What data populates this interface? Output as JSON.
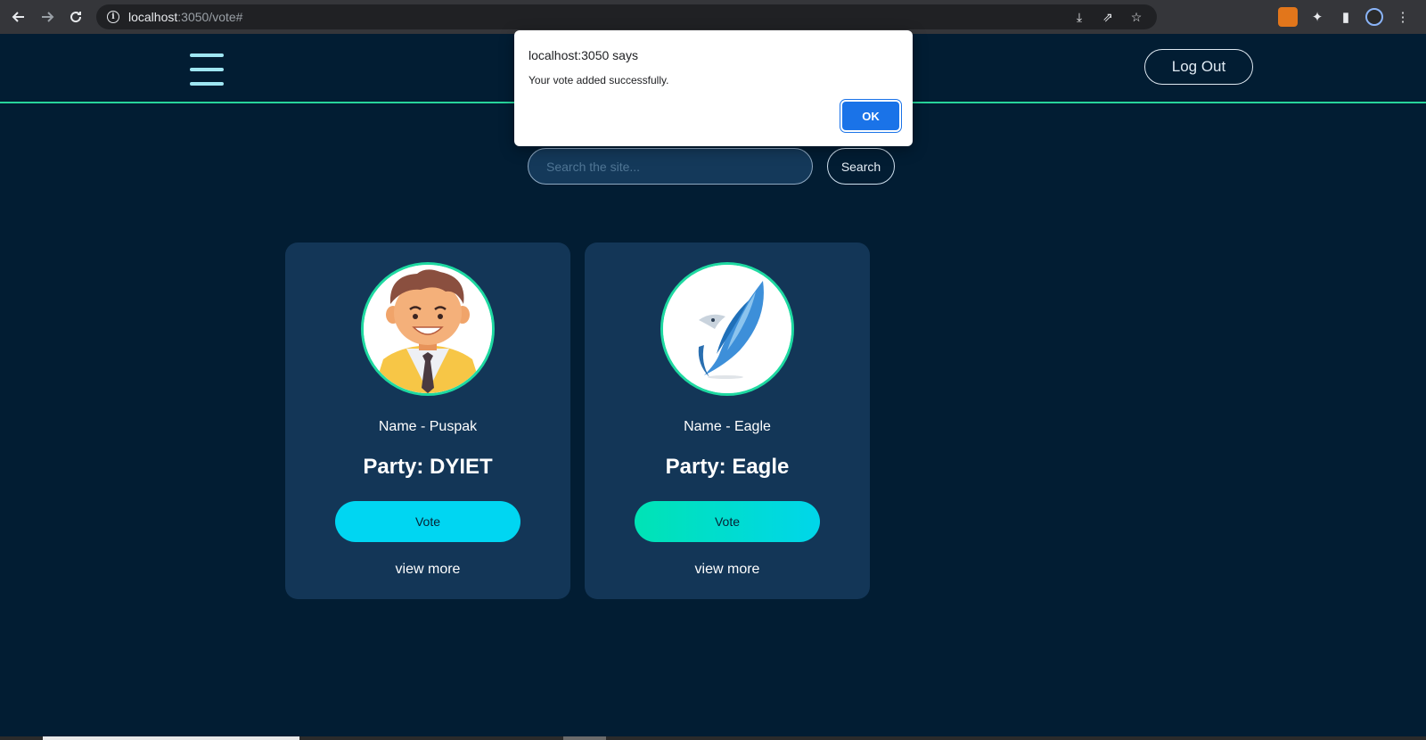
{
  "browser": {
    "url_host": "localhost",
    "url_rest": ":3050/vote#",
    "icons": [
      "back-arrow-icon",
      "forward-arrow-icon",
      "reload-icon",
      "info-icon",
      "install-icon",
      "share-icon",
      "star-icon",
      "metamask-icon",
      "extensions-icon",
      "side-panel-icon",
      "profile-icon",
      "kebab-menu-icon"
    ]
  },
  "header": {
    "logout_label": "Log Out"
  },
  "search": {
    "placeholder": "Search the site...",
    "button_label": "Search"
  },
  "candidates": [
    {
      "name": "Name - Puspak",
      "party": "Party: DYIET",
      "vote_label": "Vote",
      "view_more": "view more",
      "avatar": "man-avatar-image"
    },
    {
      "name": "Name - Eagle",
      "party": "Party: Eagle",
      "vote_label": "Vote",
      "view_more": "view more",
      "avatar": "eagle-logo-image"
    }
  ],
  "dialog": {
    "title": "localhost:3050 says",
    "message": "Your vote added successfully.",
    "ok_label": "OK"
  },
  "colors": {
    "background": "#021d33",
    "card": "#133657",
    "accent": "#27d49b",
    "vote_cyan": "#00d6f2"
  }
}
